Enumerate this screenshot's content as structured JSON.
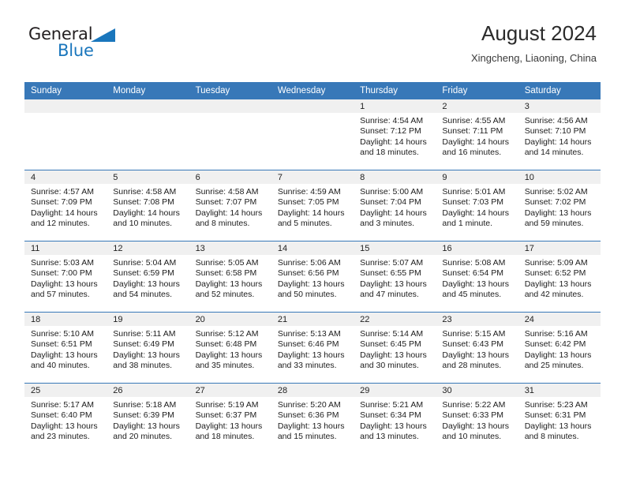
{
  "brand": {
    "name_part1": "General",
    "name_part2": "Blue",
    "triangle_color": "#1a76bc"
  },
  "header": {
    "title": "August 2024",
    "subtitle": "Xingcheng, Liaoning, China",
    "header_bg": "#3878b8",
    "daynum_bg": "#f0f0f0"
  },
  "weekday_headers": [
    "Sunday",
    "Monday",
    "Tuesday",
    "Wednesday",
    "Thursday",
    "Friday",
    "Saturday"
  ],
  "labels": {
    "sunrise_prefix": "Sunrise: ",
    "sunset_prefix": "Sunset: ",
    "daylight_prefix": "Daylight: "
  },
  "weeks": [
    [
      {
        "day": "",
        "sunrise": "",
        "sunset": "",
        "daylight_line1": "",
        "daylight_line2": ""
      },
      {
        "day": "",
        "sunrise": "",
        "sunset": "",
        "daylight_line1": "",
        "daylight_line2": ""
      },
      {
        "day": "",
        "sunrise": "",
        "sunset": "",
        "daylight_line1": "",
        "daylight_line2": ""
      },
      {
        "day": "",
        "sunrise": "",
        "sunset": "",
        "daylight_line1": "",
        "daylight_line2": ""
      },
      {
        "day": "1",
        "sunrise": "Sunrise: 4:54 AM",
        "sunset": "Sunset: 7:12 PM",
        "daylight_line1": "Daylight: 14 hours",
        "daylight_line2": "and 18 minutes."
      },
      {
        "day": "2",
        "sunrise": "Sunrise: 4:55 AM",
        "sunset": "Sunset: 7:11 PM",
        "daylight_line1": "Daylight: 14 hours",
        "daylight_line2": "and 16 minutes."
      },
      {
        "day": "3",
        "sunrise": "Sunrise: 4:56 AM",
        "sunset": "Sunset: 7:10 PM",
        "daylight_line1": "Daylight: 14 hours",
        "daylight_line2": "and 14 minutes."
      }
    ],
    [
      {
        "day": "4",
        "sunrise": "Sunrise: 4:57 AM",
        "sunset": "Sunset: 7:09 PM",
        "daylight_line1": "Daylight: 14 hours",
        "daylight_line2": "and 12 minutes."
      },
      {
        "day": "5",
        "sunrise": "Sunrise: 4:58 AM",
        "sunset": "Sunset: 7:08 PM",
        "daylight_line1": "Daylight: 14 hours",
        "daylight_line2": "and 10 minutes."
      },
      {
        "day": "6",
        "sunrise": "Sunrise: 4:58 AM",
        "sunset": "Sunset: 7:07 PM",
        "daylight_line1": "Daylight: 14 hours",
        "daylight_line2": "and 8 minutes."
      },
      {
        "day": "7",
        "sunrise": "Sunrise: 4:59 AM",
        "sunset": "Sunset: 7:05 PM",
        "daylight_line1": "Daylight: 14 hours",
        "daylight_line2": "and 5 minutes."
      },
      {
        "day": "8",
        "sunrise": "Sunrise: 5:00 AM",
        "sunset": "Sunset: 7:04 PM",
        "daylight_line1": "Daylight: 14 hours",
        "daylight_line2": "and 3 minutes."
      },
      {
        "day": "9",
        "sunrise": "Sunrise: 5:01 AM",
        "sunset": "Sunset: 7:03 PM",
        "daylight_line1": "Daylight: 14 hours",
        "daylight_line2": "and 1 minute."
      },
      {
        "day": "10",
        "sunrise": "Sunrise: 5:02 AM",
        "sunset": "Sunset: 7:02 PM",
        "daylight_line1": "Daylight: 13 hours",
        "daylight_line2": "and 59 minutes."
      }
    ],
    [
      {
        "day": "11",
        "sunrise": "Sunrise: 5:03 AM",
        "sunset": "Sunset: 7:00 PM",
        "daylight_line1": "Daylight: 13 hours",
        "daylight_line2": "and 57 minutes."
      },
      {
        "day": "12",
        "sunrise": "Sunrise: 5:04 AM",
        "sunset": "Sunset: 6:59 PM",
        "daylight_line1": "Daylight: 13 hours",
        "daylight_line2": "and 54 minutes."
      },
      {
        "day": "13",
        "sunrise": "Sunrise: 5:05 AM",
        "sunset": "Sunset: 6:58 PM",
        "daylight_line1": "Daylight: 13 hours",
        "daylight_line2": "and 52 minutes."
      },
      {
        "day": "14",
        "sunrise": "Sunrise: 5:06 AM",
        "sunset": "Sunset: 6:56 PM",
        "daylight_line1": "Daylight: 13 hours",
        "daylight_line2": "and 50 minutes."
      },
      {
        "day": "15",
        "sunrise": "Sunrise: 5:07 AM",
        "sunset": "Sunset: 6:55 PM",
        "daylight_line1": "Daylight: 13 hours",
        "daylight_line2": "and 47 minutes."
      },
      {
        "day": "16",
        "sunrise": "Sunrise: 5:08 AM",
        "sunset": "Sunset: 6:54 PM",
        "daylight_line1": "Daylight: 13 hours",
        "daylight_line2": "and 45 minutes."
      },
      {
        "day": "17",
        "sunrise": "Sunrise: 5:09 AM",
        "sunset": "Sunset: 6:52 PM",
        "daylight_line1": "Daylight: 13 hours",
        "daylight_line2": "and 42 minutes."
      }
    ],
    [
      {
        "day": "18",
        "sunrise": "Sunrise: 5:10 AM",
        "sunset": "Sunset: 6:51 PM",
        "daylight_line1": "Daylight: 13 hours",
        "daylight_line2": "and 40 minutes."
      },
      {
        "day": "19",
        "sunrise": "Sunrise: 5:11 AM",
        "sunset": "Sunset: 6:49 PM",
        "daylight_line1": "Daylight: 13 hours",
        "daylight_line2": "and 38 minutes."
      },
      {
        "day": "20",
        "sunrise": "Sunrise: 5:12 AM",
        "sunset": "Sunset: 6:48 PM",
        "daylight_line1": "Daylight: 13 hours",
        "daylight_line2": "and 35 minutes."
      },
      {
        "day": "21",
        "sunrise": "Sunrise: 5:13 AM",
        "sunset": "Sunset: 6:46 PM",
        "daylight_line1": "Daylight: 13 hours",
        "daylight_line2": "and 33 minutes."
      },
      {
        "day": "22",
        "sunrise": "Sunrise: 5:14 AM",
        "sunset": "Sunset: 6:45 PM",
        "daylight_line1": "Daylight: 13 hours",
        "daylight_line2": "and 30 minutes."
      },
      {
        "day": "23",
        "sunrise": "Sunrise: 5:15 AM",
        "sunset": "Sunset: 6:43 PM",
        "daylight_line1": "Daylight: 13 hours",
        "daylight_line2": "and 28 minutes."
      },
      {
        "day": "24",
        "sunrise": "Sunrise: 5:16 AM",
        "sunset": "Sunset: 6:42 PM",
        "daylight_line1": "Daylight: 13 hours",
        "daylight_line2": "and 25 minutes."
      }
    ],
    [
      {
        "day": "25",
        "sunrise": "Sunrise: 5:17 AM",
        "sunset": "Sunset: 6:40 PM",
        "daylight_line1": "Daylight: 13 hours",
        "daylight_line2": "and 23 minutes."
      },
      {
        "day": "26",
        "sunrise": "Sunrise: 5:18 AM",
        "sunset": "Sunset: 6:39 PM",
        "daylight_line1": "Daylight: 13 hours",
        "daylight_line2": "and 20 minutes."
      },
      {
        "day": "27",
        "sunrise": "Sunrise: 5:19 AM",
        "sunset": "Sunset: 6:37 PM",
        "daylight_line1": "Daylight: 13 hours",
        "daylight_line2": "and 18 minutes."
      },
      {
        "day": "28",
        "sunrise": "Sunrise: 5:20 AM",
        "sunset": "Sunset: 6:36 PM",
        "daylight_line1": "Daylight: 13 hours",
        "daylight_line2": "and 15 minutes."
      },
      {
        "day": "29",
        "sunrise": "Sunrise: 5:21 AM",
        "sunset": "Sunset: 6:34 PM",
        "daylight_line1": "Daylight: 13 hours",
        "daylight_line2": "and 13 minutes."
      },
      {
        "day": "30",
        "sunrise": "Sunrise: 5:22 AM",
        "sunset": "Sunset: 6:33 PM",
        "daylight_line1": "Daylight: 13 hours",
        "daylight_line2": "and 10 minutes."
      },
      {
        "day": "31",
        "sunrise": "Sunrise: 5:23 AM",
        "sunset": "Sunset: 6:31 PM",
        "daylight_line1": "Daylight: 13 hours",
        "daylight_line2": "and 8 minutes."
      }
    ]
  ]
}
